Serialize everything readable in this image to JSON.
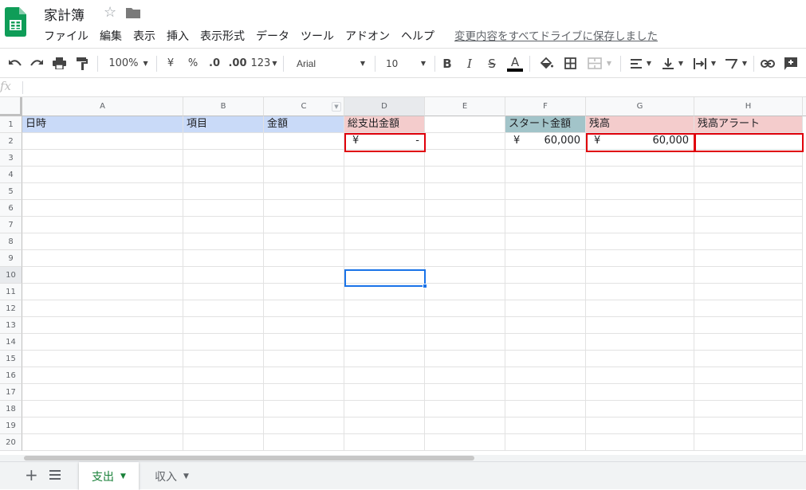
{
  "app": {
    "doc_title": "家計簿",
    "save_status": "変更内容をすべてドライブに保存しました",
    "menus": [
      "ファイル",
      "編集",
      "表示",
      "挿入",
      "表示形式",
      "データ",
      "ツール",
      "アドオン",
      "ヘルプ"
    ]
  },
  "toolbar": {
    "zoom": "100%",
    "currency": "¥",
    "percent": "%",
    "decimal_decrease": ".0",
    "decimal_increase": ".00",
    "more_formats": "123",
    "font": "Arial",
    "font_size": "10",
    "bold": "B",
    "italic": "I",
    "strike": "S",
    "text_color": "A"
  },
  "formula_bar": {
    "fx": "fx",
    "value": ""
  },
  "columns": [
    "A",
    "B",
    "C",
    "D",
    "E",
    "F",
    "G",
    "H"
  ],
  "rows": [
    "1",
    "2",
    "3",
    "4",
    "5",
    "6",
    "7",
    "8",
    "9",
    "10",
    "11",
    "12",
    "13",
    "14",
    "15",
    "16",
    "17",
    "18",
    "19",
    "20"
  ],
  "cells": {
    "A1": "日時",
    "B1": "項目",
    "C1": "金額",
    "D1": "総支出金額",
    "F1": "スタート金額",
    "G1": "残高",
    "H1": "残高アラート",
    "D2": {
      "sym": "¥",
      "val": "-"
    },
    "F2": {
      "sym": "¥",
      "val": "60,000"
    },
    "G2": {
      "sym": "¥",
      "val": "60,000"
    },
    "H2": ""
  },
  "colors": {
    "header_blue": "#c9daf8",
    "header_pink": "#f4cccc",
    "header_teal": "#a2c4c9",
    "highlight_red": "#e0000a",
    "selection_blue": "#1a73e8",
    "sheet_active": "#188038"
  },
  "selected_cell": "D10",
  "sheets": [
    {
      "name": "支出",
      "active": true
    },
    {
      "name": "収入",
      "active": false
    }
  ],
  "sheetbar_icons": [
    "add-sheet-icon",
    "all-sheets-icon"
  ]
}
